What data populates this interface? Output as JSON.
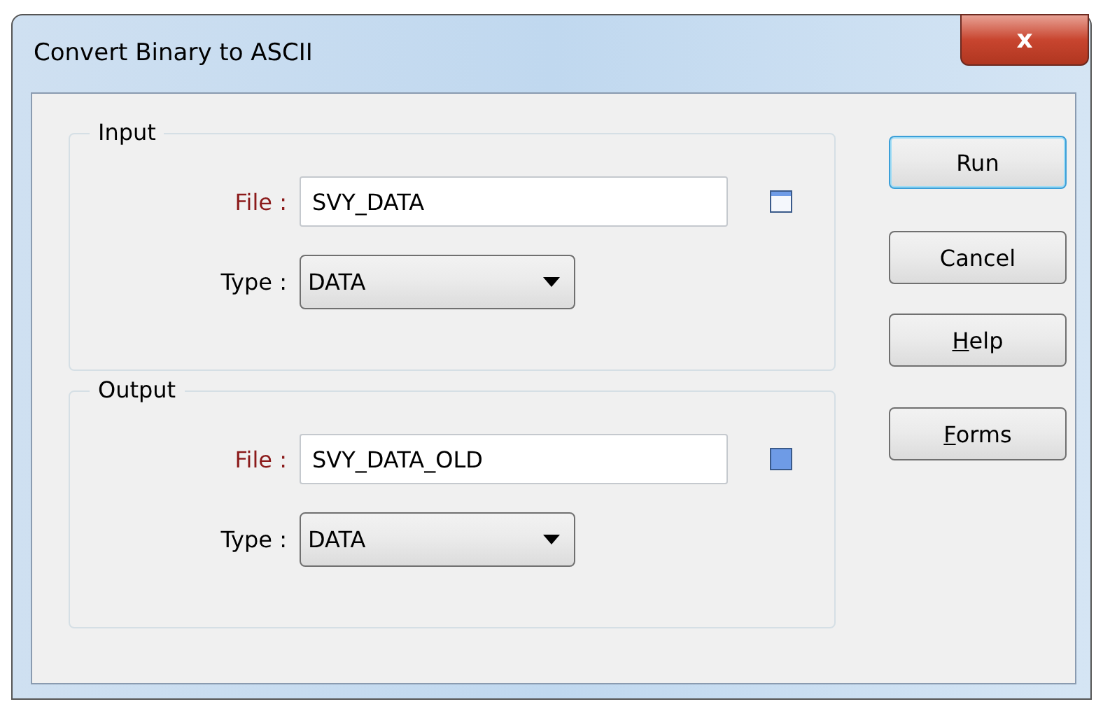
{
  "window": {
    "title": "Convert Binary to ASCII",
    "close_glyph": "x"
  },
  "groups": [
    {
      "title": "Input",
      "file": {
        "label": "File :",
        "required": true,
        "value": "SVY_DATA",
        "browse_filled": false
      },
      "type": {
        "label": "Type :",
        "required": false,
        "value": "DATA"
      }
    },
    {
      "title": "Output",
      "file": {
        "label": "File :",
        "required": true,
        "value": "SVY_DATA_OLD",
        "browse_filled": true
      },
      "type": {
        "label": "Type :",
        "required": false,
        "value": "DATA"
      }
    }
  ],
  "buttons": [
    {
      "rest": "Run",
      "default": true
    },
    {
      "rest": "Cancel",
      "default": false
    },
    {
      "mnemonic": "H",
      "rest": "elp",
      "default": false
    },
    {
      "mnemonic": "F",
      "rest": "orms",
      "default": false
    }
  ]
}
